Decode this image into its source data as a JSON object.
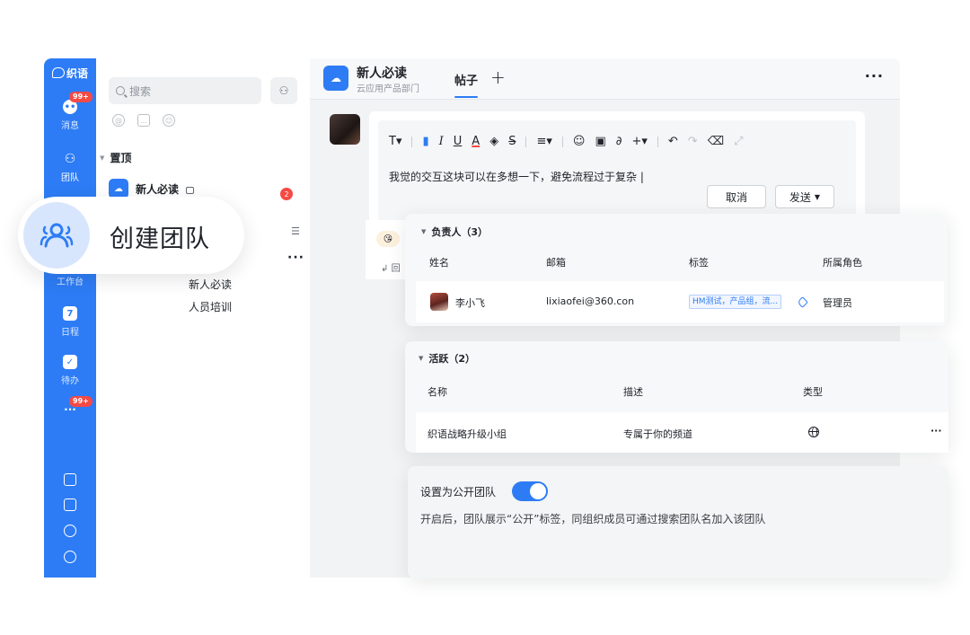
{
  "rail": {
    "logo": "织语",
    "items": [
      {
        "label": "消息",
        "badge": "99+"
      },
      {
        "label": "团队",
        "badge": ""
      },
      {
        "label": "工作台",
        "badge": ""
      },
      {
        "label": "日程",
        "badge": ""
      },
      {
        "label": "待办",
        "badge": ""
      },
      {
        "label": "",
        "badge": "99+"
      }
    ],
    "bottom_icons": [
      "bookmark-icon",
      "download-icon",
      "bot-icon",
      "settings-icon"
    ]
  },
  "list": {
    "search_placeholder": "搜索",
    "pinned_section": "置顶",
    "pinned_team": "新人必读",
    "pinned_badge": "2",
    "sub_items": [
      "新人必读",
      "人员培训"
    ],
    "more_glyph": "···"
  },
  "create_team": {
    "label": "创建团队"
  },
  "header": {
    "team_name": "新人必读",
    "team_desc": "云应用产品部门",
    "tab": "帖子",
    "add_tab": "+",
    "more": "···"
  },
  "editor": {
    "text": "我觉的交互这块可以在多想一下，避免流程过于复杂 |",
    "cancel": "取消",
    "send": "发送",
    "reply": "回"
  },
  "owners": {
    "title": "负责人（3）",
    "columns": [
      "姓名",
      "邮箱",
      "标签",
      "所属角色"
    ],
    "rows": [
      {
        "name": "李小飞",
        "email": "lixiaofei@360.con",
        "tags": "HM测试，产品组，流...",
        "role": "管理员"
      }
    ]
  },
  "active": {
    "title": "活跃（2）",
    "columns": [
      "名称",
      "描述",
      "类型"
    ],
    "rows": [
      {
        "name": "织语战略升级小组",
        "desc": "专属于你的频道",
        "type_icon": "globe-icon"
      }
    ]
  },
  "public_setting": {
    "label": "设置为公开团队",
    "enabled": true,
    "desc": "开启后，团队展示“公开”标签，同组织成员可通过搜索团队名加入该团队"
  },
  "colors": {
    "accent": "#2d7cf5",
    "badge": "#f54a45"
  }
}
